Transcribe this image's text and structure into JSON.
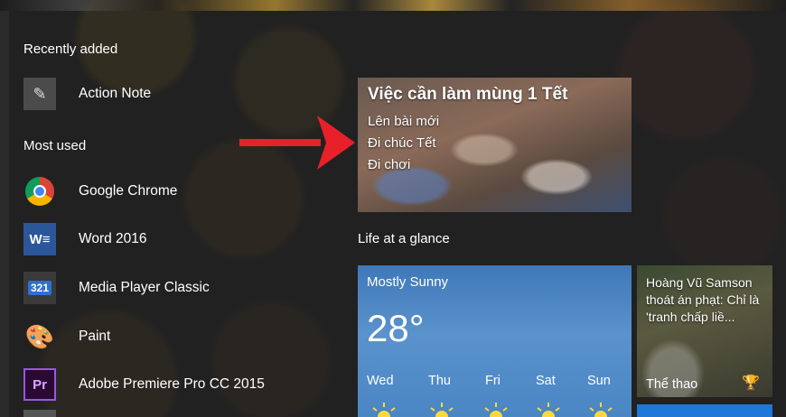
{
  "start_menu": {
    "recently_added_label": "Recently added",
    "most_used_label": "Most used",
    "recent_apps": [
      {
        "name": "Action Note",
        "icon": "action-note-icon"
      }
    ],
    "most_used_apps": [
      {
        "name": "Google Chrome",
        "icon": "chrome-icon"
      },
      {
        "name": "Word 2016",
        "icon": "word-icon",
        "icon_text": "W"
      },
      {
        "name": "Media Player Classic",
        "icon": "media-player-classic-icon",
        "icon_text": "321"
      },
      {
        "name": "Paint",
        "icon": "paint-icon"
      },
      {
        "name": "Adobe Premiere Pro CC 2015",
        "icon": "premiere-pro-icon",
        "icon_text": "Pr"
      }
    ]
  },
  "tiles": {
    "todo": {
      "title": "Việc cần làm mùng 1 Tết",
      "items": [
        "Lên bài mới",
        "Đi chúc Tết",
        "Đi chơi"
      ]
    },
    "group_label": "Life at a glance",
    "weather": {
      "condition": "Mostly Sunny",
      "temperature": "28°",
      "days": [
        "Wed",
        "Thu",
        "Fri",
        "Sat",
        "Sun"
      ]
    },
    "news": {
      "headline": "Hoàng Vũ Samson thoát án phạt: Chỉ là 'tranh chấp liề...",
      "category": "Thể thao"
    }
  },
  "colors": {
    "word_blue": "#2b579a",
    "premiere_purple": "#9a59d6",
    "weather_blue": "#4a86c4",
    "arrow_red": "#e8202a",
    "accent_blue": "#1e78d8"
  }
}
